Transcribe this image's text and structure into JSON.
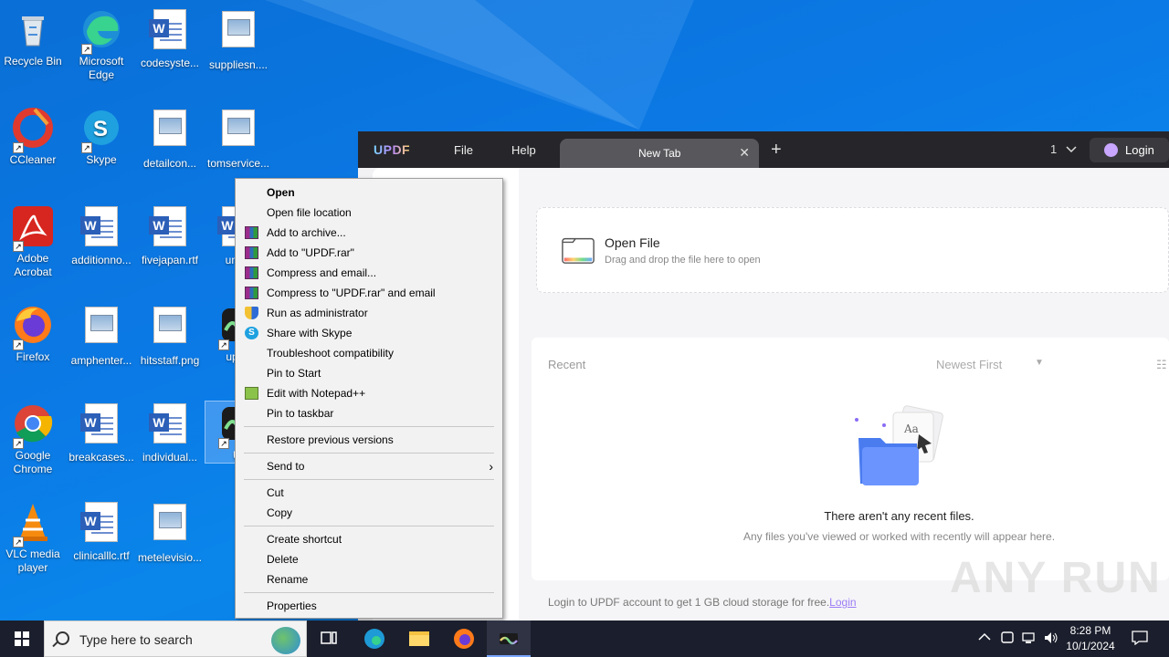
{
  "desktop": {
    "icons": [
      {
        "label": "Recycle Bin",
        "icon": "recycle-bin-icon"
      },
      {
        "label": "Microsoft Edge",
        "icon": "edge-icon"
      },
      {
        "label": "codesyste...",
        "icon": "word-doc-icon"
      },
      {
        "label": "suppliesn....",
        "icon": "image-file-icon"
      },
      {
        "label": "CCleaner",
        "icon": "ccleaner-icon"
      },
      {
        "label": "Skype",
        "icon": "skype-icon"
      },
      {
        "label": "detailcon...",
        "icon": "image-file-icon"
      },
      {
        "label": "tomservice...",
        "icon": "image-file-icon"
      },
      {
        "label": "Adobe Acrobat",
        "icon": "acrobat-icon"
      },
      {
        "label": "additionno...",
        "icon": "word-doc-icon"
      },
      {
        "label": "fivejapan.rtf",
        "icon": "word-doc-icon"
      },
      {
        "label": "unles",
        "icon": "word-doc-icon"
      },
      {
        "label": "Firefox",
        "icon": "firefox-icon"
      },
      {
        "label": "amphenter...",
        "icon": "image-file-icon"
      },
      {
        "label": "hitsstaff.png",
        "icon": "image-file-icon"
      },
      {
        "label": "updf-",
        "icon": "updf-icon"
      },
      {
        "label": "Google Chrome",
        "icon": "chrome-icon"
      },
      {
        "label": "breakcases...",
        "icon": "word-doc-icon"
      },
      {
        "label": "individual...",
        "icon": "word-doc-icon"
      },
      {
        "label": "UI",
        "icon": "updf-icon"
      },
      {
        "label": "VLC media player",
        "icon": "vlc-icon"
      },
      {
        "label": "clinicalllc.rtf",
        "icon": "word-doc-icon"
      },
      {
        "label": "metelevisio...",
        "icon": "image-file-icon"
      }
    ]
  },
  "updf": {
    "logo": "UPDF",
    "menu": {
      "file": "File",
      "help": "Help"
    },
    "tab": {
      "label": "New Tab",
      "close": "✕"
    },
    "new_tab": "+",
    "page_select": "1",
    "login_label": "Login",
    "open_file": {
      "title": "Open File",
      "subtitle": "Drag and drop the file here to open"
    },
    "recent": {
      "label": "Recent",
      "sort": "Newest First",
      "empty_title": "There aren't any recent files.",
      "empty_sub": "Any files you've viewed or worked with recently will appear here."
    },
    "footer": {
      "text": "Login to UPDF account to get 1 GB cloud storage for free.",
      "link": "Login"
    }
  },
  "context_menu": {
    "groups": [
      [
        {
          "label": "Open",
          "bold": true,
          "icon": ""
        },
        {
          "label": "Open file location",
          "icon": ""
        },
        {
          "label": "Add to archive...",
          "icon": "winrar-icon"
        },
        {
          "label": "Add to \"UPDF.rar\"",
          "icon": "winrar-icon"
        },
        {
          "label": "Compress and email...",
          "icon": "winrar-icon"
        },
        {
          "label": "Compress to \"UPDF.rar\" and email",
          "icon": "winrar-icon"
        },
        {
          "label": "Run as administrator",
          "icon": "uac-shield-icon"
        },
        {
          "label": "Share with Skype",
          "icon": "skype-icon"
        },
        {
          "label": "Troubleshoot compatibility",
          "icon": ""
        },
        {
          "label": "Pin to Start",
          "icon": ""
        },
        {
          "label": "Edit with Notepad++",
          "icon": "notepadpp-icon"
        },
        {
          "label": "Pin to taskbar",
          "icon": ""
        }
      ],
      [
        {
          "label": "Restore previous versions",
          "icon": ""
        }
      ],
      [
        {
          "label": "Send to",
          "icon": "",
          "submenu": true
        }
      ],
      [
        {
          "label": "Cut",
          "icon": ""
        },
        {
          "label": "Copy",
          "icon": ""
        }
      ],
      [
        {
          "label": "Create shortcut",
          "icon": ""
        },
        {
          "label": "Delete",
          "icon": ""
        },
        {
          "label": "Rename",
          "icon": ""
        }
      ],
      [
        {
          "label": "Properties",
          "icon": ""
        }
      ]
    ]
  },
  "taskbar": {
    "search_placeholder": "Type here to search",
    "time": "8:28 PM",
    "date": "10/1/2024"
  },
  "watermark": "ANY RUN"
}
